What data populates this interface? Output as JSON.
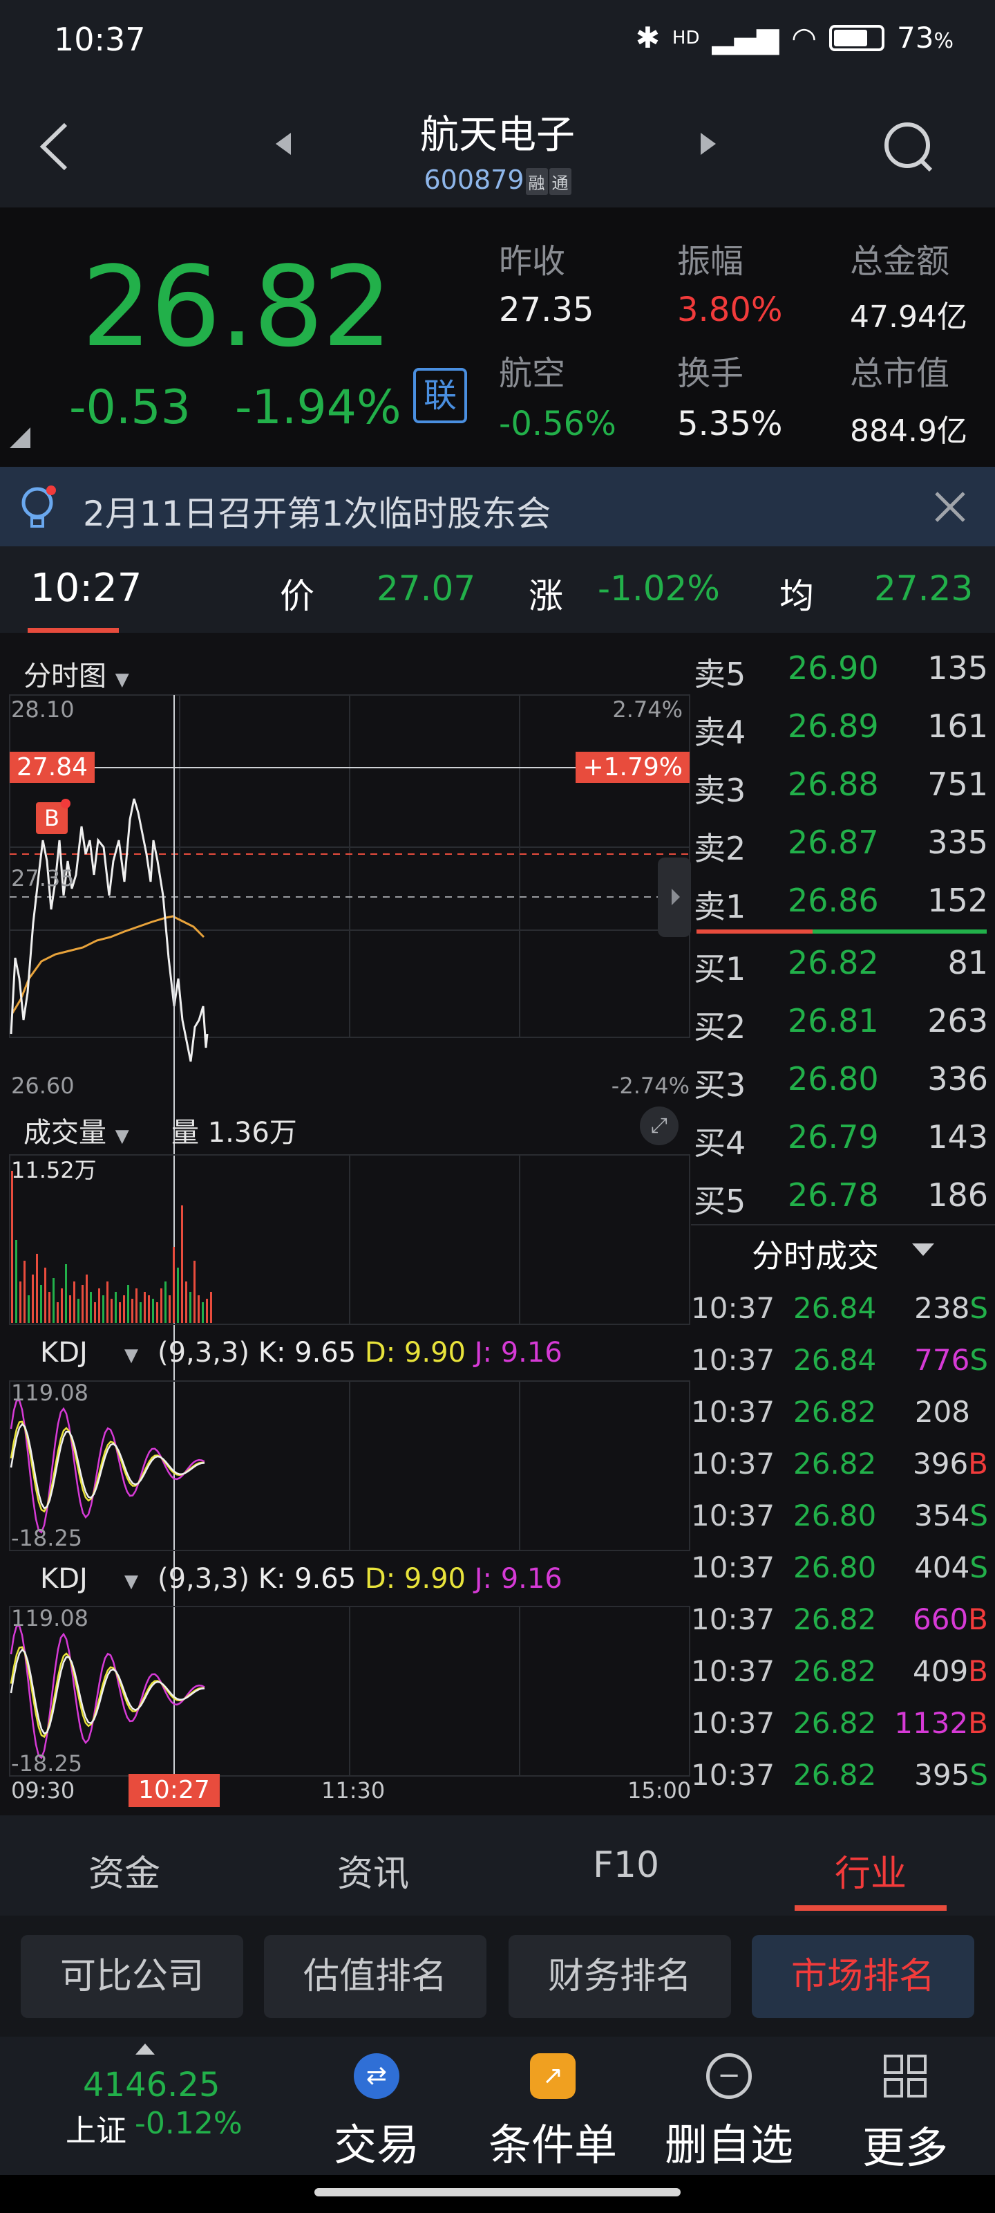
{
  "status_bar": {
    "time": "10:37",
    "battery": "73",
    "battery_unit": "%",
    "signal": "HD"
  },
  "header": {
    "stock_name": "航天电子",
    "stock_code": "600879",
    "tag_rong": "融",
    "tag_tong": "通"
  },
  "quote": {
    "price": "26.82",
    "change": "-0.53",
    "change_pct": "-1.94%",
    "link_badge": "联",
    "prev_close_label": "昨收",
    "prev_close": "27.35",
    "amplitude_label": "振幅",
    "amplitude": "3.80%",
    "total_amount_label": "总金额",
    "total_amount": "47.94亿",
    "sector_label": "航空",
    "sector_change": "-0.56%",
    "turnover_label": "换手",
    "turnover": "5.35%",
    "market_cap_label": "总市值",
    "market_cap": "884.9亿",
    "colors": {
      "down": "#22b04a",
      "up": "#f23b3b",
      "accent": "#4a8fe0"
    }
  },
  "notice": {
    "text": "2月11日召开第1次临时股东会"
  },
  "cursor": {
    "time": "10:27",
    "price_label": "价",
    "price": "27.07",
    "change_label": "涨",
    "change": "-1.02%",
    "avg_label": "均",
    "avg": "27.23"
  },
  "intraday": {
    "title": "分时图",
    "y_max": "28.10",
    "y_min": "26.60",
    "pct_max": "2.74%",
    "pct_min": "-2.74%",
    "mid_label": "27.35",
    "cursor_price_tag": "27.84",
    "cursor_pct_tag": "+1.79%",
    "buy_marker": "B",
    "x_labels": [
      "09:30",
      "11:30",
      "15:00"
    ],
    "x_cursor_label": "10:27"
  },
  "volume": {
    "title": "成交量",
    "value_label": "量 1.36万",
    "y_max": "11.52万"
  },
  "kdj1": {
    "title": "KDJ",
    "params": "(9,3,3)",
    "k": "K: 9.65",
    "d": "D: 9.90",
    "j": "J: 9.16",
    "y_max": "119.08",
    "y_min": "-18.25"
  },
  "kdj2": {
    "title": "KDJ",
    "params": "(9,3,3)",
    "k": "K: 9.65",
    "d": "D: 9.90",
    "j": "J: 9.16",
    "y_max": "119.08",
    "y_min": "-18.25"
  },
  "order_book": {
    "asks": [
      {
        "label": "卖5",
        "price": "26.90",
        "vol": "135"
      },
      {
        "label": "卖4",
        "price": "26.89",
        "vol": "161"
      },
      {
        "label": "卖3",
        "price": "26.88",
        "vol": "751"
      },
      {
        "label": "卖2",
        "price": "26.87",
        "vol": "335"
      },
      {
        "label": "卖1",
        "price": "26.86",
        "vol": "152"
      }
    ],
    "bids": [
      {
        "label": "买1",
        "price": "26.82",
        "vol": "81"
      },
      {
        "label": "买2",
        "price": "26.81",
        "vol": "263"
      },
      {
        "label": "买3",
        "price": "26.80",
        "vol": "336"
      },
      {
        "label": "买4",
        "price": "26.79",
        "vol": "143"
      },
      {
        "label": "买5",
        "price": "26.78",
        "vol": "186"
      }
    ]
  },
  "trades": {
    "title": "分时成交",
    "rows": [
      {
        "time": "10:37",
        "price": "26.84",
        "vol": "238",
        "side": "S",
        "vol_color": "#d0d2d5",
        "side_color": "#22b04a"
      },
      {
        "time": "10:37",
        "price": "26.84",
        "vol": "776",
        "side": "S",
        "vol_color": "#d63ad6",
        "side_color": "#22b04a"
      },
      {
        "time": "10:37",
        "price": "26.82",
        "vol": "208",
        "side": "",
        "vol_color": "#d0d2d5",
        "side_color": "#22b04a"
      },
      {
        "time": "10:37",
        "price": "26.82",
        "vol": "396",
        "side": "B",
        "vol_color": "#d0d2d5",
        "side_color": "#f23b3b"
      },
      {
        "time": "10:37",
        "price": "26.80",
        "vol": "354",
        "side": "S",
        "vol_color": "#d0d2d5",
        "side_color": "#22b04a"
      },
      {
        "time": "10:37",
        "price": "26.80",
        "vol": "404",
        "side": "S",
        "vol_color": "#d0d2d5",
        "side_color": "#22b04a"
      },
      {
        "time": "10:37",
        "price": "26.82",
        "vol": "660",
        "side": "B",
        "vol_color": "#d63ad6",
        "side_color": "#f23b3b"
      },
      {
        "time": "10:37",
        "price": "26.82",
        "vol": "409",
        "side": "B",
        "vol_color": "#d0d2d5",
        "side_color": "#f23b3b"
      },
      {
        "time": "10:37",
        "price": "26.82",
        "vol": "1132",
        "side": "B",
        "vol_color": "#d63ad6",
        "side_color": "#f23b3b"
      },
      {
        "time": "10:37",
        "price": "26.82",
        "vol": "395",
        "side": "S",
        "vol_color": "#d0d2d5",
        "side_color": "#22b04a"
      }
    ]
  },
  "tabs": {
    "items": [
      "资金",
      "资讯",
      "F10",
      "行业"
    ],
    "active": "行业"
  },
  "sub_tabs": {
    "items": [
      "可比公司",
      "估值排名",
      "财务排名",
      "市场排名"
    ],
    "active": "市场排名"
  },
  "bottom_nav": {
    "index_value": "4146.25",
    "index_name": "上证",
    "index_change": "-0.12%",
    "items": [
      "交易",
      "条件单",
      "删自选",
      "更多"
    ]
  }
}
